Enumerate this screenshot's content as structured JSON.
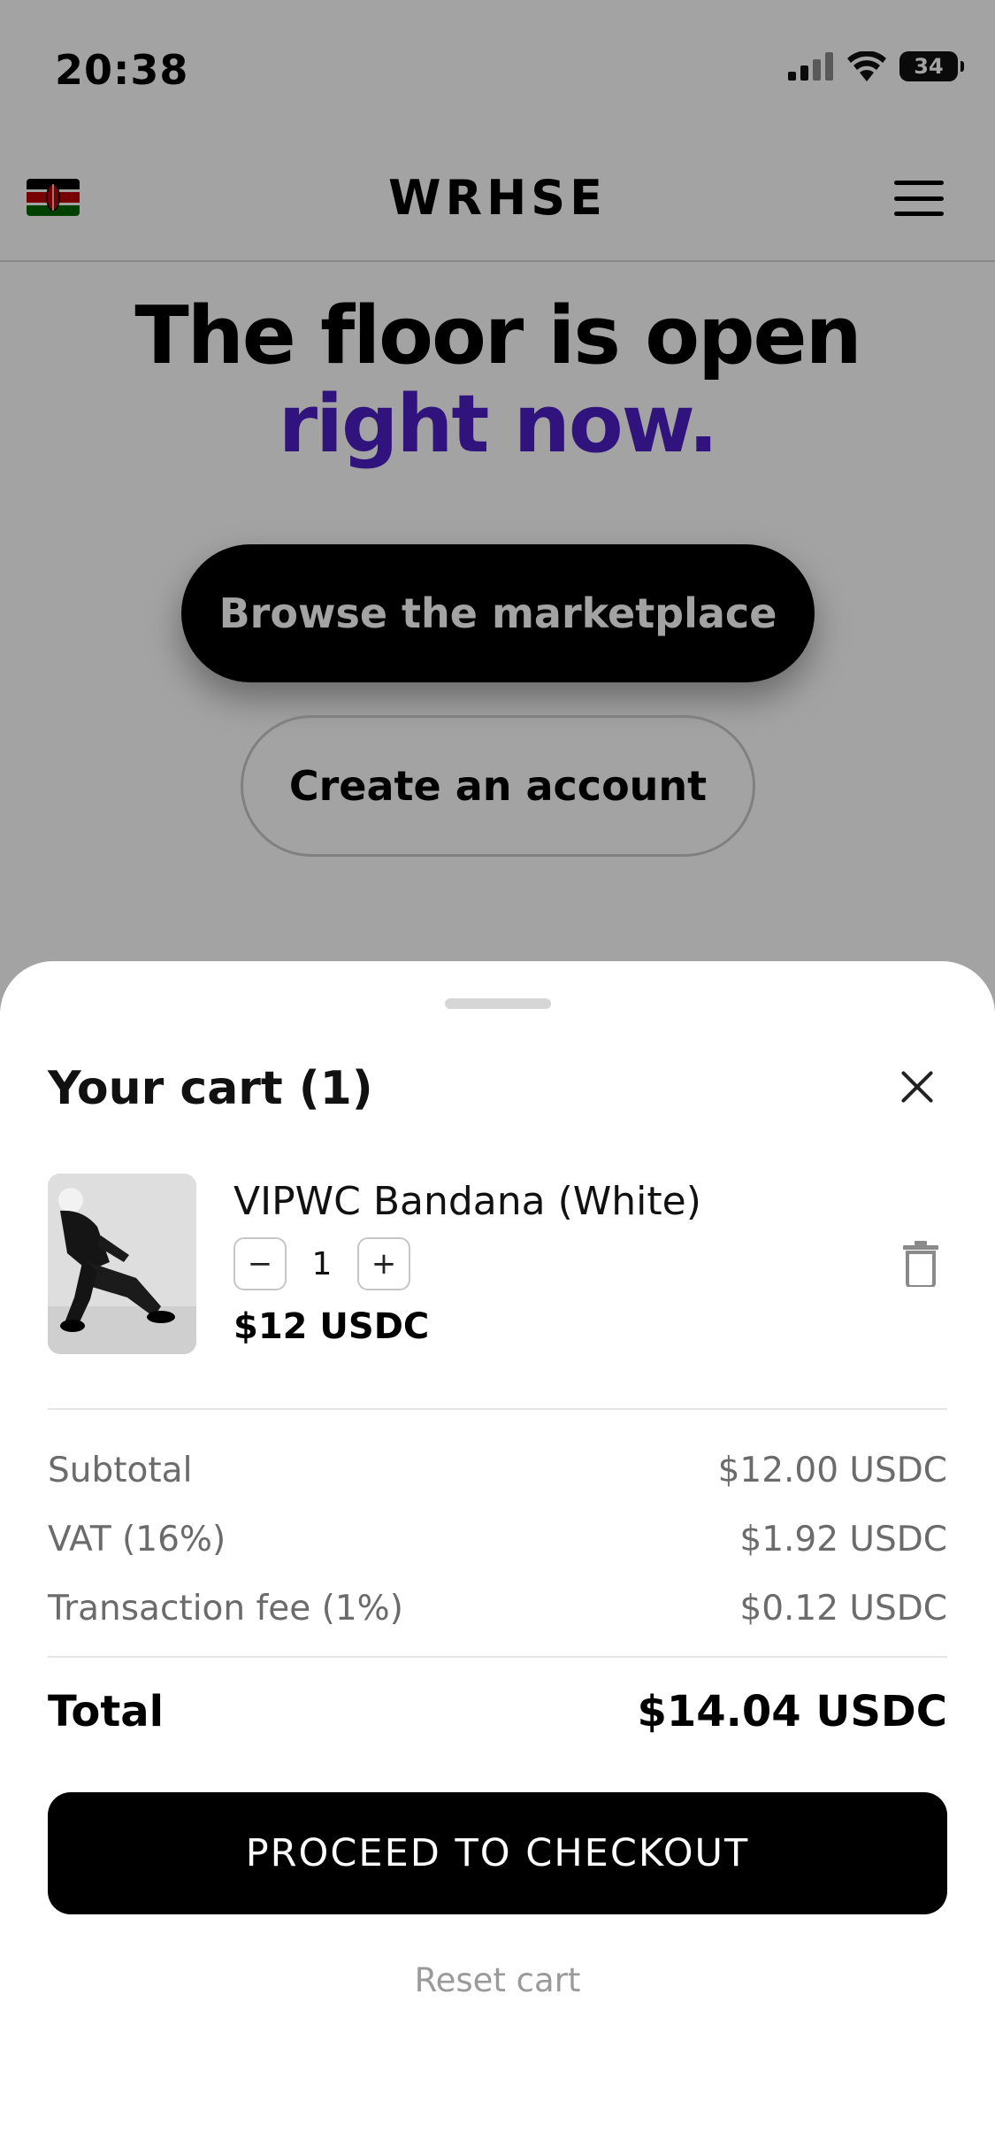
{
  "status_bar": {
    "time": "20:38",
    "battery": "34",
    "icons": [
      "signal-icon",
      "wifi-icon",
      "battery-icon"
    ]
  },
  "nav": {
    "brand": "WRHSE",
    "flag_icon": "kenya-flag-icon",
    "menu_icon": "hamburger-menu-icon"
  },
  "hero": {
    "line1": "The floor is open",
    "line2": "right now.",
    "primary_cta": "Browse the marketplace",
    "secondary_cta": "Create an account"
  },
  "cart": {
    "title": "Your cart (1)",
    "item": {
      "name": "VIPWC Bandana (White)",
      "quantity": "1",
      "decrement_label": "−",
      "increment_label": "+",
      "price": "$12 USDC"
    },
    "summary": {
      "subtotal_label": "Subtotal",
      "subtotal_value": "$12.00 USDC",
      "vat_label": "VAT (16%)",
      "vat_value": "$1.92 USDC",
      "fee_label": "Transaction fee (1%)",
      "fee_value": "$0.12 USDC",
      "total_label": "Total",
      "total_value": "$14.04 USDC"
    },
    "checkout_label": "PROCEED TO CHECKOUT",
    "reset_label": "Reset cart"
  },
  "colors": {
    "accent": "#4b1fc2",
    "button": "#000000",
    "muted_text": "#6b6b6b"
  }
}
